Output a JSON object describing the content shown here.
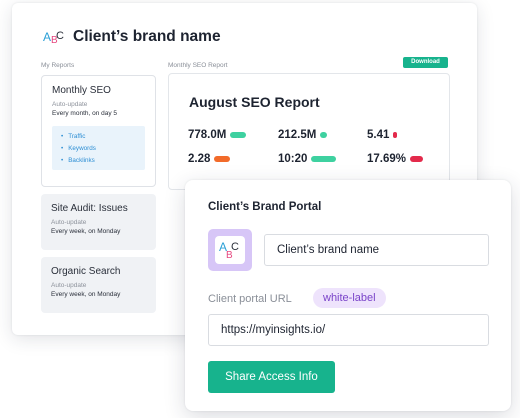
{
  "header": {
    "brand_name": "Client’s brand name",
    "logo_icon": "abc-letters-logo-icon"
  },
  "sidebar": {
    "label": "My Reports",
    "reports": [
      {
        "title": "Monthly SEO",
        "subtitle": "Auto-update",
        "frequency": "Every month, on day 5",
        "metrics": [
          "Traffic",
          "Keywords",
          "Backlinks"
        ]
      },
      {
        "title": "Site Audit: Issues",
        "subtitle": "Auto-update",
        "frequency": "Every week, on Monday"
      },
      {
        "title": "Organic Search",
        "subtitle": "Auto-update",
        "frequency": "Every week, on Monday"
      }
    ]
  },
  "main": {
    "label": "Monthly SEO Report",
    "download_label": "Download",
    "report_title": "August SEO Report",
    "metrics": [
      {
        "value": "778.0M",
        "color": "#3ed1a0"
      },
      {
        "value": "212.5M",
        "color": "#3ed1a0"
      },
      {
        "value": "5.41",
        "color": "#e32a4b"
      },
      {
        "value": "2.28",
        "color": "#f26b2a"
      },
      {
        "value": "10:20",
        "color": "#3ed1a0"
      },
      {
        "value": "17.69%",
        "color": "#e32a4b"
      }
    ]
  },
  "portal": {
    "title": "Client’s Brand Portal",
    "brand_name_value": "Client’s brand name",
    "url_label": "Client portal URL",
    "url_badge": "white-label",
    "url_value": "https://myinsights.io/",
    "share_button": "Share Access Info",
    "logo_icon": "abc-letters-logo-icon"
  },
  "colors": {
    "accent_green": "#17b38d",
    "badge_purple": "#7a43c9",
    "badge_purple_bg": "#eee3fc",
    "logo_purple_bg": "#d7c6f7"
  }
}
